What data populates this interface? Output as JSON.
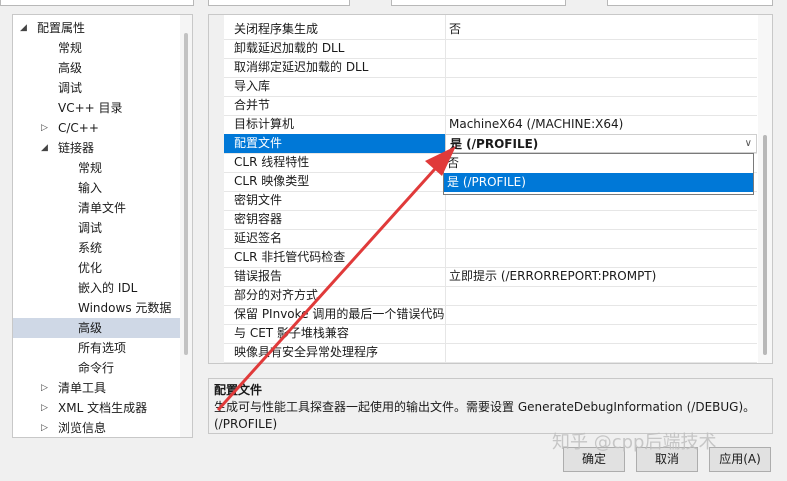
{
  "tree": {
    "items": [
      {
        "label": "配置属性",
        "level": 0,
        "toggle": "◢",
        "selected": false
      },
      {
        "label": "常规",
        "level": 1,
        "selected": false
      },
      {
        "label": "高级",
        "level": 1,
        "selected": false
      },
      {
        "label": "调试",
        "level": 1,
        "selected": false
      },
      {
        "label": "VC++ 目录",
        "level": 1,
        "selected": false
      },
      {
        "label": "C/C++",
        "level": 1,
        "toggle": "▷",
        "selected": false
      },
      {
        "label": "链接器",
        "level": 1,
        "toggle": "◢",
        "selected": false
      },
      {
        "label": "常规",
        "level": 2,
        "selected": false
      },
      {
        "label": "输入",
        "level": 2,
        "selected": false
      },
      {
        "label": "清单文件",
        "level": 2,
        "selected": false
      },
      {
        "label": "调试",
        "level": 2,
        "selected": false
      },
      {
        "label": "系统",
        "level": 2,
        "selected": false
      },
      {
        "label": "优化",
        "level": 2,
        "selected": false
      },
      {
        "label": "嵌入的 IDL",
        "level": 2,
        "selected": false
      },
      {
        "label": "Windows 元数据",
        "level": 2,
        "selected": false
      },
      {
        "label": "高级",
        "level": 2,
        "selected": true
      },
      {
        "label": "所有选项",
        "level": 2,
        "selected": false
      },
      {
        "label": "命令行",
        "level": 2,
        "selected": false
      },
      {
        "label": "清单工具",
        "level": 1,
        "toggle": "▷",
        "selected": false
      },
      {
        "label": "XML 文档生成器",
        "level": 1,
        "toggle": "▷",
        "selected": false
      },
      {
        "label": "浏览信息",
        "level": 1,
        "toggle": "▷",
        "selected": false
      }
    ]
  },
  "grid": {
    "rows": [
      {
        "name": "关闭程序集生成",
        "value": "否"
      },
      {
        "name": "卸载延迟加载的 DLL",
        "value": ""
      },
      {
        "name": "取消绑定延迟加载的 DLL",
        "value": ""
      },
      {
        "name": "导入库",
        "value": ""
      },
      {
        "name": "合并节",
        "value": ""
      },
      {
        "name": "目标计算机",
        "value": "MachineX64 (/MACHINE:X64)"
      },
      {
        "name": "配置文件",
        "value": "是 (/PROFILE)",
        "selected": true
      },
      {
        "name": "CLR 线程特性",
        "value": ""
      },
      {
        "name": "CLR 映像类型",
        "value": ""
      },
      {
        "name": "密钥文件",
        "value": ""
      },
      {
        "name": "密钥容器",
        "value": ""
      },
      {
        "name": "延迟签名",
        "value": ""
      },
      {
        "name": "CLR 非托管代码检查",
        "value": ""
      },
      {
        "name": "错误报告",
        "value": "立即提示 (/ERRORREPORT:PROMPT)"
      },
      {
        "name": "部分的对齐方式",
        "value": ""
      },
      {
        "name": "保留 PInvoke 调用的最后一个错误代码",
        "value": ""
      },
      {
        "name": "与 CET 影子堆栈兼容",
        "value": ""
      },
      {
        "name": "映像具有安全异常处理程序",
        "value": ""
      }
    ]
  },
  "dropdown": {
    "options": [
      {
        "label": "否",
        "selected": false
      },
      {
        "label": "是 (/PROFILE)",
        "selected": true
      }
    ]
  },
  "description": {
    "title": "配置文件",
    "body": "生成可与性能工具探查器一起使用的输出文件。需要设置 GenerateDebugInformation (/DEBUG)。(/PROFILE)"
  },
  "buttons": {
    "ok": "确定",
    "cancel": "取消",
    "apply": "应用(A)"
  },
  "watermark": "知乎 @cpp后端技术",
  "colors": {
    "selection": "#0078d7",
    "arrow": "#e03a3a",
    "tree_selection": "#cfd8e6"
  }
}
